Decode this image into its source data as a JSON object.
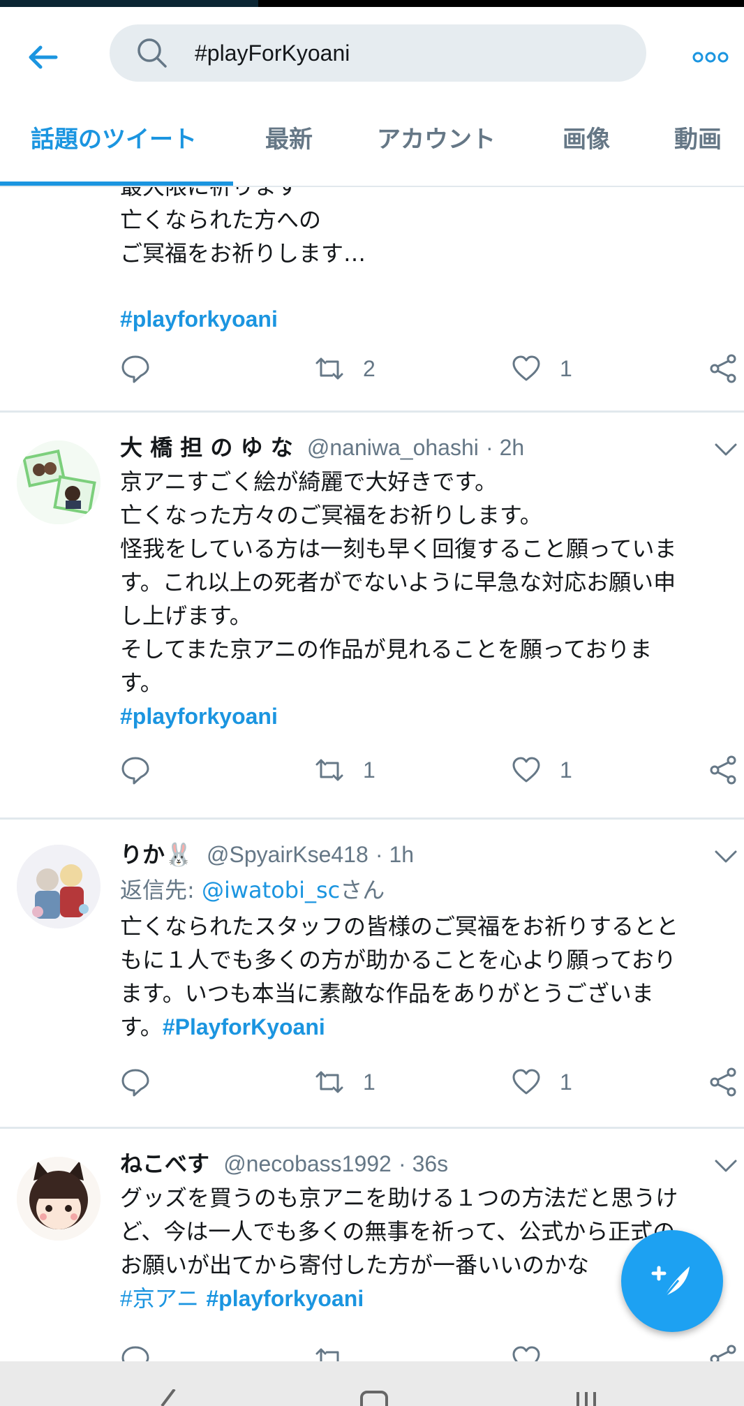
{
  "search": {
    "query": "#playForKyoani"
  },
  "tabs": [
    "話題のツイート",
    "最新",
    "アカウント",
    "画像",
    "動画"
  ],
  "icons": {
    "back": "arrow-left-icon",
    "search": "search-icon",
    "more": "more-horizontal-icon",
    "reply": "reply-icon",
    "retweet": "retweet-icon",
    "like": "heart-icon",
    "share": "share-icon",
    "compose": "compose-tweet-icon"
  },
  "colors": {
    "accent": "#1b95e0",
    "fab": "#1da1f2",
    "muted": "#657786",
    "search_bg": "#e6ecf0"
  },
  "tweets": [
    {
      "lines": [
        "最大限に祈ります",
        "亡くなられた方への",
        "ご冥福をお祈りします…"
      ],
      "hashtag": "#playforkyoani",
      "retweets": "2",
      "likes": "1"
    },
    {
      "name": "大 橋 担 の ゆ な",
      "handle": "@naniwa_ohashi",
      "time": "2h",
      "lines": [
        "京アニすごく絵が綺麗で大好きです。",
        "亡くなった方々のご冥福をお祈りします。",
        "怪我をしている方は一刻も早く回復すること願っていま",
        "す。これ以上の死者がでないように早急な対応お願い申",
        "し上げます。",
        "そしてまた京アニの作品が見れることを願っておりま",
        "す。"
      ],
      "hashtag": "#playforkyoani",
      "retweets": "1",
      "likes": "1"
    },
    {
      "name": "りか🐰",
      "handle": "@SpyairKse418",
      "time": "1h",
      "reply_label": "返信先: ",
      "reply_to": "@iwatobi_sc",
      "reply_suffix": "さん",
      "lines": [
        "亡くなられたスタッフの皆様のご冥福をお祈りするとと",
        "もに１人でも多くの方が助かることを心より願っており",
        "ます。いつも本当に素敵な作品をありがとうございま"
      ],
      "last_line_prefix": "す。",
      "hashtag": "#PlayforKyoani",
      "retweets": "1",
      "likes": "1"
    },
    {
      "name": "ねこべす",
      "handle": "@necobass1992",
      "time": "36s",
      "lines": [
        "グッズを買うのも京アニを助ける１つの方法だと思うけ",
        "ど、今は一人でも多くの無事を祈って、公式から正式の",
        "お願いが出てから寄付した方が一番いいのかな"
      ],
      "hashtag1": "#京アニ",
      "hashtag": "#playforkyoani"
    }
  ]
}
